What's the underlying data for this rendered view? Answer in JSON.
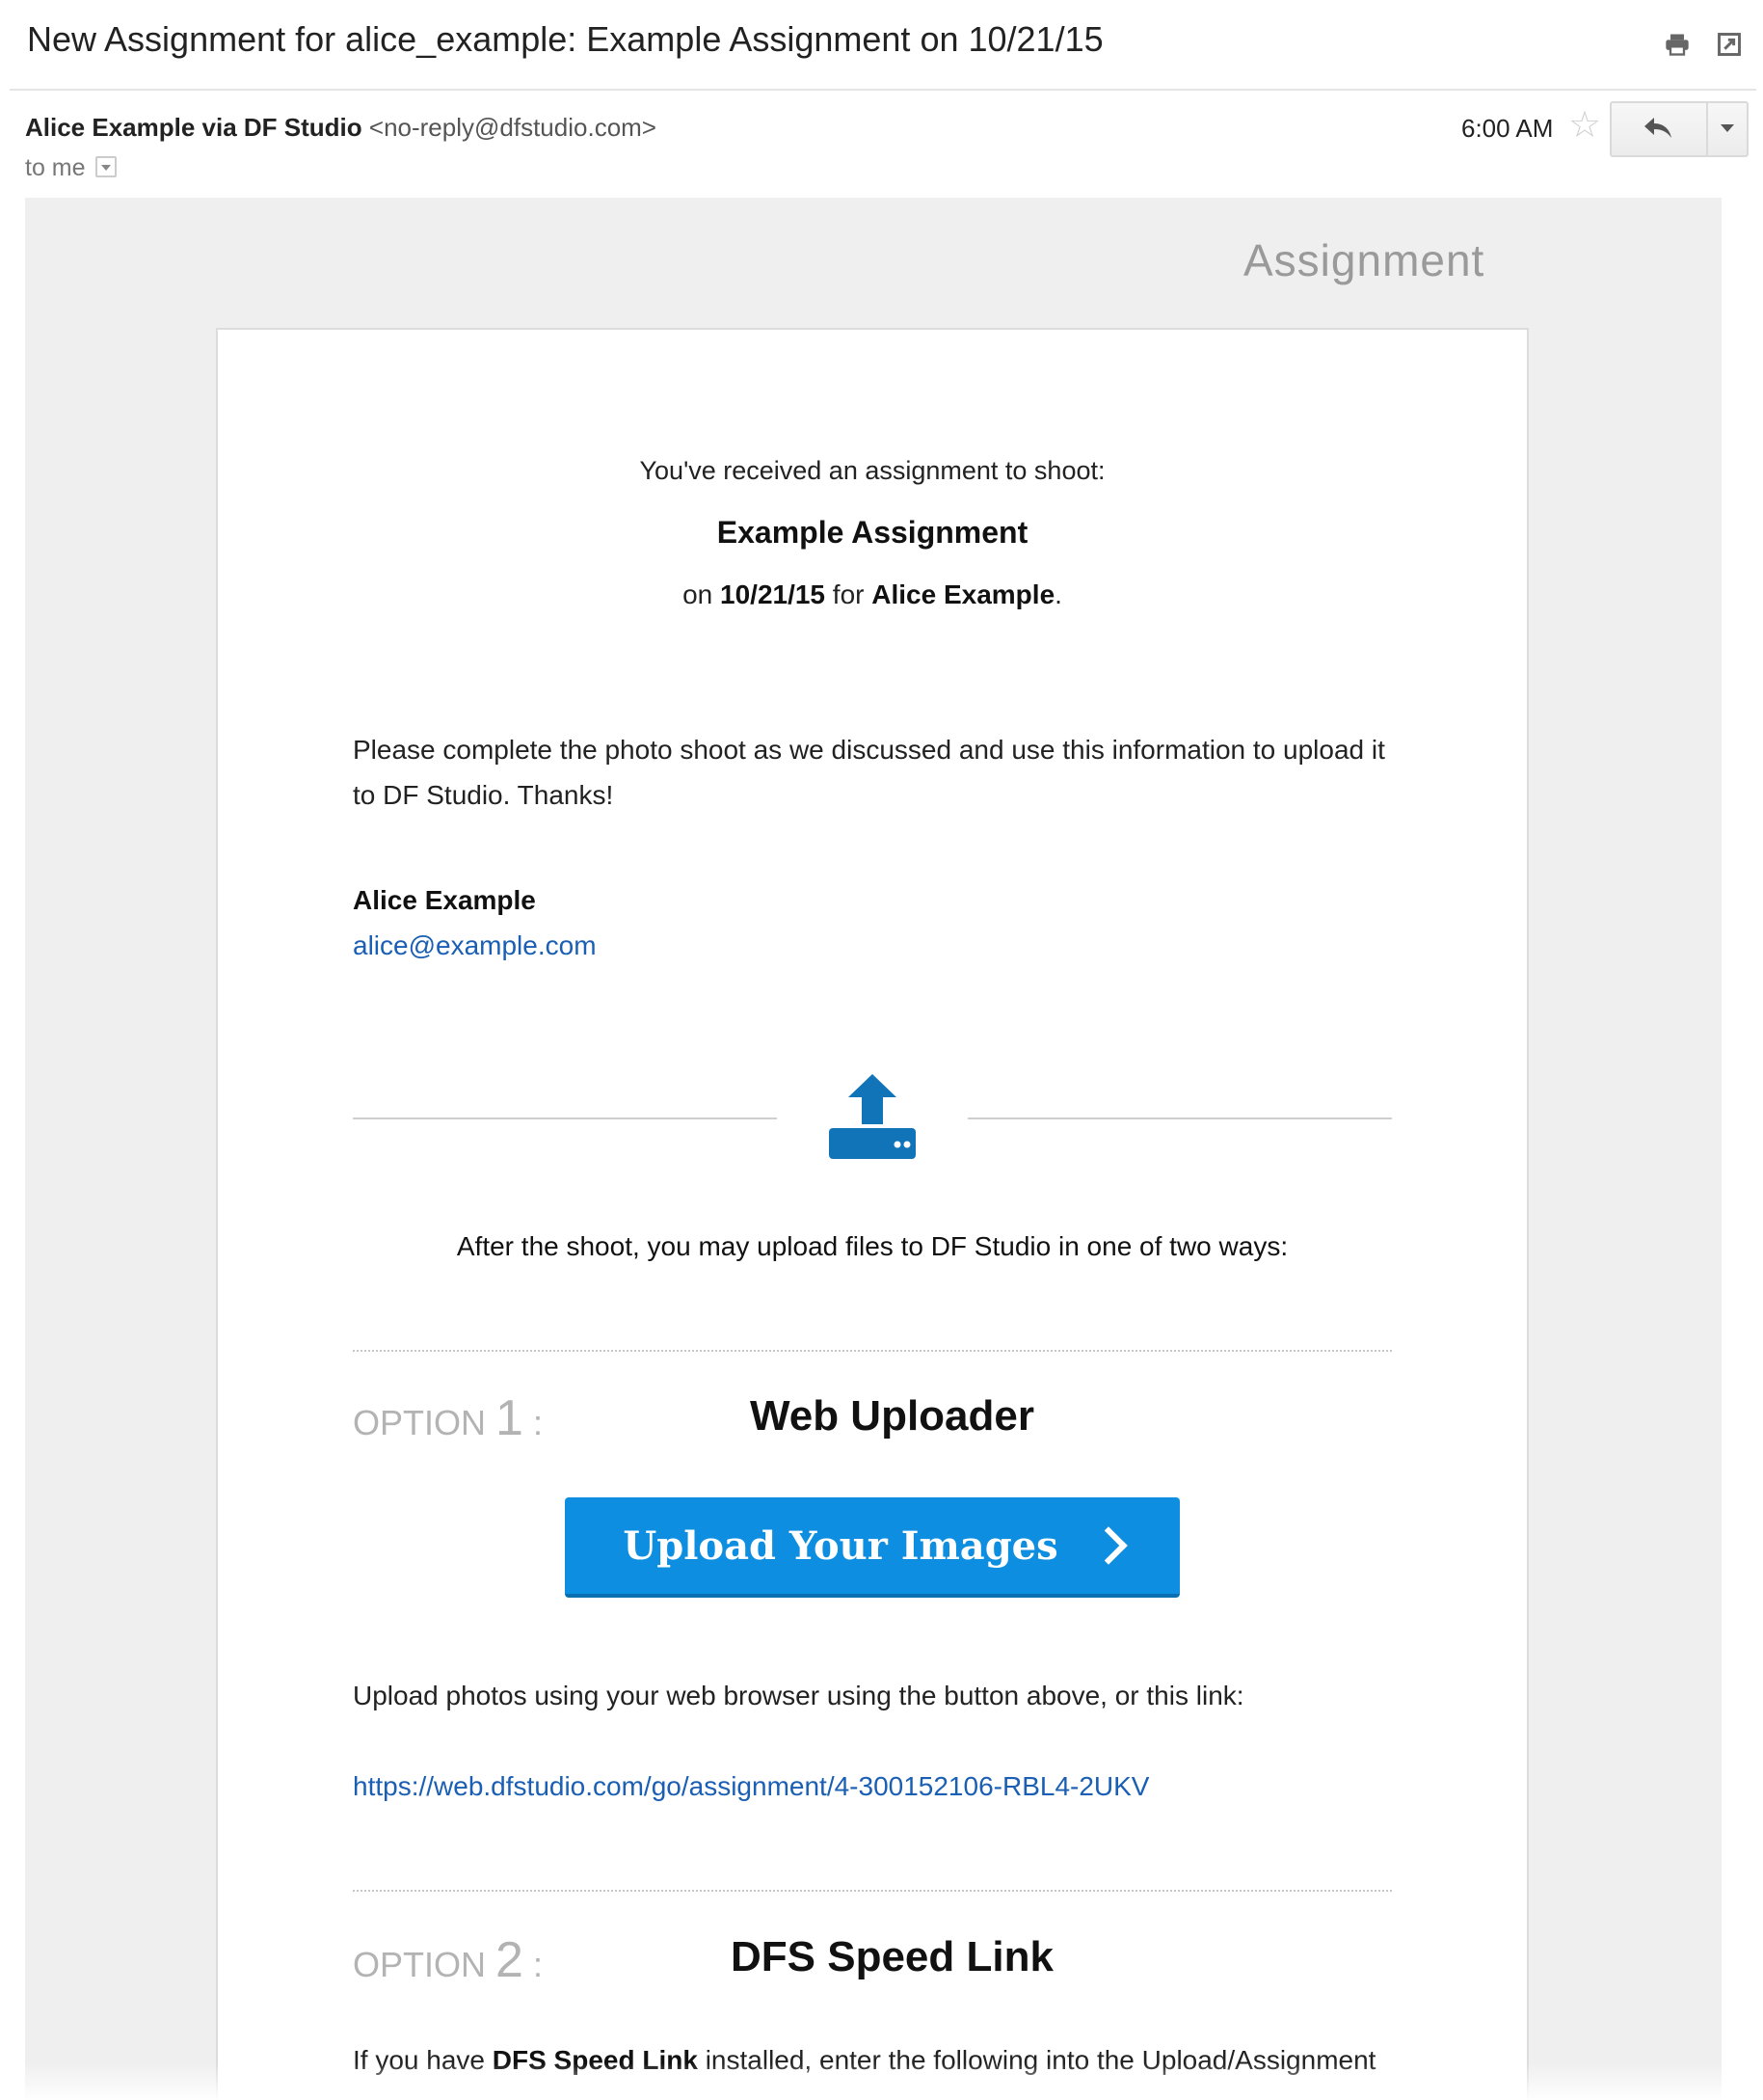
{
  "subject": "New Assignment for alice_example: Example Assignment on 10/21/15",
  "header_icons": [
    "print-icon",
    "new-window-icon"
  ],
  "sender": {
    "name": "Alice Example via DF Studio",
    "email": "<no-reply@dfstudio.com>",
    "recipient": "to me",
    "time": "6:00 AM"
  },
  "email_body": {
    "heading": "Assignment",
    "intro": "You've received an assignment to shoot:",
    "assignment_name": "Example Assignment",
    "on_prefix": "on",
    "date": "10/21/15",
    "for_text": "for",
    "client": "Alice Example",
    "period": ".",
    "message_line1": "Please complete the photo shoot as we discussed and use this information to upload it",
    "message_line2": "to DF Studio. Thanks!",
    "signature_name": "Alice Example",
    "signature_email": "alice@example.com",
    "after_shoot": "After the shoot, you may upload files to DF Studio in one of two ways:",
    "option1": {
      "label": "OPTION",
      "number": "1",
      "colon": ":",
      "title": "Web Uploader",
      "button": "Upload Your Images",
      "description": "Upload photos using your web browser using the button above, or this link:",
      "link": "https://web.dfstudio.com/go/assignment/4-300152106-RBL4-2UKV"
    },
    "option2": {
      "label": "OPTION",
      "number": "2",
      "colon": ":",
      "title": "DFS Speed Link",
      "desc_prefix": "If you have",
      "desc_bold": "DFS Speed Link",
      "desc_suffix": "installed, enter the following into the Upload/Assignment"
    }
  },
  "colors": {
    "accent_blue": "#0d8ee0",
    "link_blue": "#1a5fb4",
    "icon_blue": "#1174b8"
  }
}
